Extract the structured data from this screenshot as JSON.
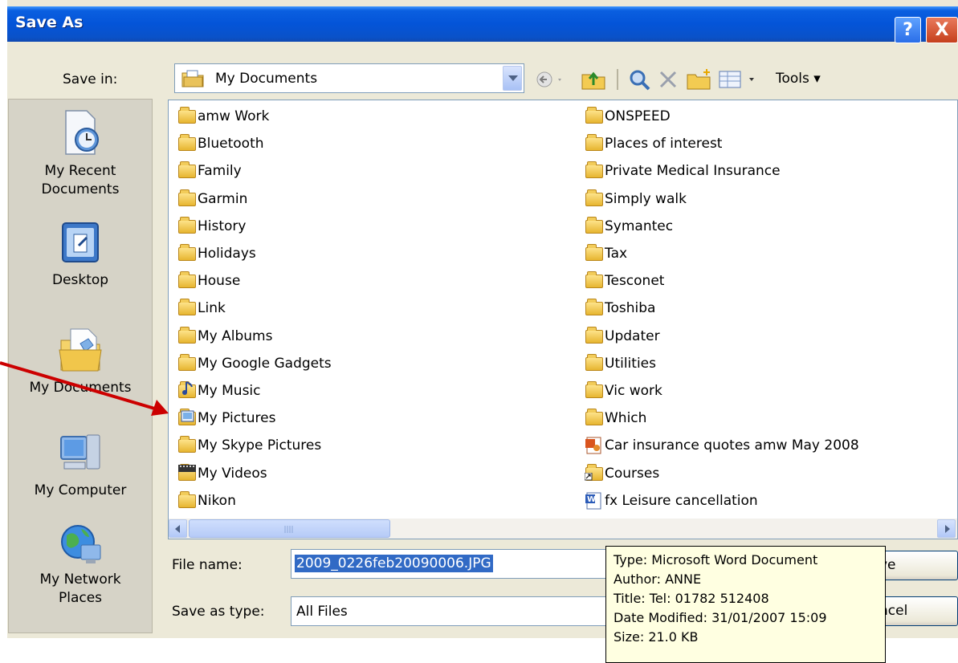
{
  "window": {
    "title": "Save As",
    "help_glyph": "?",
    "close_glyph": "X"
  },
  "toolbar": {
    "save_in_label": "Save in:",
    "save_in_value": "My Documents",
    "tools_label": "Tools ▾"
  },
  "places": [
    {
      "label_line1": "My Recent",
      "label_line2": "Documents",
      "icon": "recent-documents-icon"
    },
    {
      "label_line1": "Desktop",
      "label_line2": "",
      "icon": "desktop-icon"
    },
    {
      "label_line1": "My Documents",
      "label_line2": "",
      "icon": "my-documents-icon"
    },
    {
      "label_line1": "My Computer",
      "label_line2": "",
      "icon": "my-computer-icon"
    },
    {
      "label_line1": "My Network",
      "label_line2": "Places",
      "icon": "network-places-icon"
    }
  ],
  "files_col1": [
    {
      "name": "amw Work",
      "icon": "folder"
    },
    {
      "name": "Bluetooth",
      "icon": "folder"
    },
    {
      "name": "Family",
      "icon": "folder"
    },
    {
      "name": "Garmin",
      "icon": "folder"
    },
    {
      "name": "History",
      "icon": "folder"
    },
    {
      "name": "Holidays",
      "icon": "folder"
    },
    {
      "name": "House",
      "icon": "folder"
    },
    {
      "name": "Link",
      "icon": "folder"
    },
    {
      "name": "My Albums",
      "icon": "folder"
    },
    {
      "name": "My Google Gadgets",
      "icon": "folder"
    },
    {
      "name": "My Music",
      "icon": "music-folder"
    },
    {
      "name": "My Pictures",
      "icon": "pictures-folder"
    },
    {
      "name": "My Skype Pictures",
      "icon": "folder"
    },
    {
      "name": "My Videos",
      "icon": "videos-folder"
    },
    {
      "name": "Nikon",
      "icon": "folder"
    }
  ],
  "files_col2": [
    {
      "name": "ONSPEED",
      "icon": "folder"
    },
    {
      "name": "Places of interest",
      "icon": "folder"
    },
    {
      "name": "Private Medical Insurance",
      "icon": "folder"
    },
    {
      "name": "Simply walk",
      "icon": "folder"
    },
    {
      "name": "Symantec",
      "icon": "folder"
    },
    {
      "name": "Tax",
      "icon": "folder"
    },
    {
      "name": "Tesconet",
      "icon": "folder"
    },
    {
      "name": "Toshiba",
      "icon": "folder"
    },
    {
      "name": "Updater",
      "icon": "folder"
    },
    {
      "name": "Utilities",
      "icon": "folder"
    },
    {
      "name": "Vic work",
      "icon": "folder"
    },
    {
      "name": "Which",
      "icon": "folder"
    },
    {
      "name": "Car insurance quotes amw May 2008",
      "icon": "powerpoint-doc"
    },
    {
      "name": "Courses",
      "icon": "shortcut-folder"
    },
    {
      "name": "fx Leisure cancellation",
      "icon": "word-doc"
    }
  ],
  "form": {
    "file_name_label": "File name:",
    "file_name_value": "2009_0226feb20090006.JPG",
    "save_as_type_label": "Save as type:",
    "save_as_type_value": "All Files",
    "save_button_visible": "ve",
    "cancel_button_visible": "ncel"
  },
  "tooltip": {
    "line1": "Type: Microsoft Word Document",
    "line2": "Author:  ANNE",
    "line3": "Title: Tel: 01782 512408",
    "line4": "Date Modified: 31/01/2007 15:09",
    "line5": "Size: 21.0 KB"
  },
  "colors": {
    "titlebar": "#0454d8",
    "selection": "#316ac5",
    "annotation_arrow": "#cc0000",
    "tooltip_bg": "#ffffe1"
  }
}
